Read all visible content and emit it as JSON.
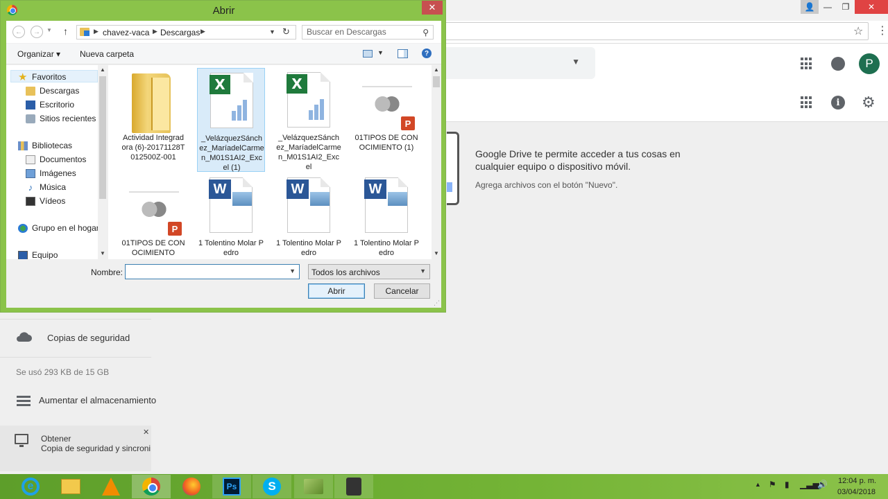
{
  "dialog": {
    "title": "Abrir",
    "close_glyph": "✕",
    "address": {
      "crumbs": [
        "chavez-vaca",
        "Descargas"
      ],
      "search_placeholder": "Buscar en Descargas"
    },
    "toolbar": {
      "organize_label": "Organizar ▾",
      "new_folder_label": "Nueva carpeta"
    },
    "nav": {
      "items": [
        {
          "label": "Favoritos",
          "icon": "star-icon"
        },
        {
          "label": "Descargas",
          "icon": "downloads-folder-icon"
        },
        {
          "label": "Escritorio",
          "icon": "desktop-icon"
        },
        {
          "label": "Sitios recientes",
          "icon": "recent-places-icon"
        },
        {
          "label": "Bibliotecas",
          "icon": "libraries-icon"
        },
        {
          "label": "Documentos",
          "icon": "documents-icon"
        },
        {
          "label": "Imágenes",
          "icon": "pictures-icon"
        },
        {
          "label": "Música",
          "icon": "music-icon"
        },
        {
          "label": "Vídeos",
          "icon": "videos-icon"
        },
        {
          "label": "Grupo en el hogar",
          "icon": "homegroup-icon"
        },
        {
          "label": "Equipo",
          "icon": "computer-icon"
        }
      ]
    },
    "files": [
      {
        "name": "Actividad Integradora (6)-20171128T012500Z-001",
        "type": "folder",
        "selected": false
      },
      {
        "name": "_VelázquezSánchez_MaríadelCarmen_M01S1AI2_Excel (1)",
        "type": "excel",
        "selected": true
      },
      {
        "name": "_VelázquezSánchez_MaríadelCarmen_M01S1AI2_Excel",
        "type": "excel",
        "selected": false
      },
      {
        "name": "01TIPOS DE CONOCIMIENTO (1)",
        "type": "powerpoint",
        "selected": false
      },
      {
        "name": "01TIPOS DE CONOCIMIENTO",
        "type": "powerpoint",
        "selected": false
      },
      {
        "name": "1 Tolentino Molar Pedro",
        "type": "word",
        "selected": false
      },
      {
        "name": "1 Tolentino Molar Pedro",
        "type": "word",
        "selected": false
      },
      {
        "name": "1 Tolentino Molar Pedro",
        "type": "word",
        "selected": false
      }
    ],
    "name_label": "Nombre:",
    "name_value": "",
    "filter_value": "Todos los archivos",
    "open_label": "Abrir",
    "cancel_label": "Cancelar"
  },
  "drive": {
    "empty_message": "Google Drive te permite acceder a tus cosas en cualquier equipo o dispositivo móvil.",
    "empty_hint": "Agrega archivos con el botón \"Nuevo\".",
    "avatar_letter": "P",
    "sidebar": {
      "backup_label": "Copias de seguridad",
      "usage_text": "Se usó 293 KB de 15 GB",
      "upgrade_label": "Aumentar el almacenamiento",
      "promo_title": "Obtener",
      "promo_desc": "Copia de seguridad y sincronización para Windows",
      "promo_close": "✕"
    }
  },
  "taskbar": {
    "apps": [
      {
        "name": "internet-explorer",
        "label": "e"
      },
      {
        "name": "file-explorer",
        "label": ""
      },
      {
        "name": "vlc",
        "label": ""
      },
      {
        "name": "chrome",
        "label": ""
      },
      {
        "name": "firefox",
        "label": ""
      },
      {
        "name": "photoshop",
        "label": "Ps"
      },
      {
        "name": "skype",
        "label": "S"
      },
      {
        "name": "green-app",
        "label": ""
      },
      {
        "name": "camera-app",
        "label": ""
      }
    ],
    "time": "12:04 p. m.",
    "date": "03/04/2018"
  },
  "colors": {
    "dialog_frame": "#8bc34a",
    "close_red": "#c75050",
    "taskbar_green": "#74b436",
    "avatar_green": "#1e6f50"
  }
}
